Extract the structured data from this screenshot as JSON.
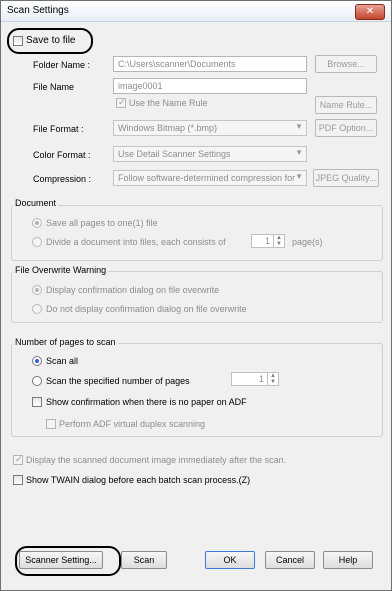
{
  "window": {
    "title": "Scan Settings",
    "close_glyph": "✕"
  },
  "save_to_file": {
    "label": "Save to file"
  },
  "folder": {
    "label": "Folder Name :",
    "value": "C:\\Users\\scanner\\Documents",
    "browse": "Browse..."
  },
  "filename": {
    "label": "File Name",
    "value": "image0001",
    "name_rule_checkbox": "Use the Name Rule",
    "name_rule_button": "Name Rule..."
  },
  "file_format": {
    "label": "File Format :",
    "value": "Windows Bitmap (*.bmp)",
    "button": "PDF Option..."
  },
  "color_format": {
    "label": "Color Format :",
    "value": "Use Detail Scanner Settings"
  },
  "compression": {
    "label": "Compression :",
    "value": "Follow software-determined compression for",
    "button": "JPEG Quality..."
  },
  "document": {
    "title": "Document",
    "opt_all": "Save all pages to one(1) file",
    "opt_divide": "Divide a document into files, each consists of",
    "divide_value": "1",
    "divide_unit": "page(s)"
  },
  "overwrite": {
    "title": "File Overwrite Warning",
    "opt_display": "Display confirmation dialog on file overwrite",
    "opt_nodisplay": "Do not display confirmation dialog on file overwrite"
  },
  "pages": {
    "title": "Number of pages to scan",
    "opt_all": "Scan all",
    "opt_specified": "Scan the specified number of pages",
    "specified_value": "1",
    "show_confirm": "Show confirmation when there is no paper on ADF",
    "virtual_duplex": "Perform ADF virtual duplex scanning"
  },
  "display_after": "Display the scanned document image immediately after the scan.",
  "show_twain": "Show TWAIN dialog before each batch scan process.(Z)",
  "buttons": {
    "scanner_setting": "Scanner Setting...",
    "scan": "Scan",
    "ok": "OK",
    "cancel": "Cancel",
    "help": "Help"
  },
  "icons": {
    "check": "✓",
    "spin_up": "▲",
    "spin_down": "▼",
    "dropdown": "▼"
  }
}
